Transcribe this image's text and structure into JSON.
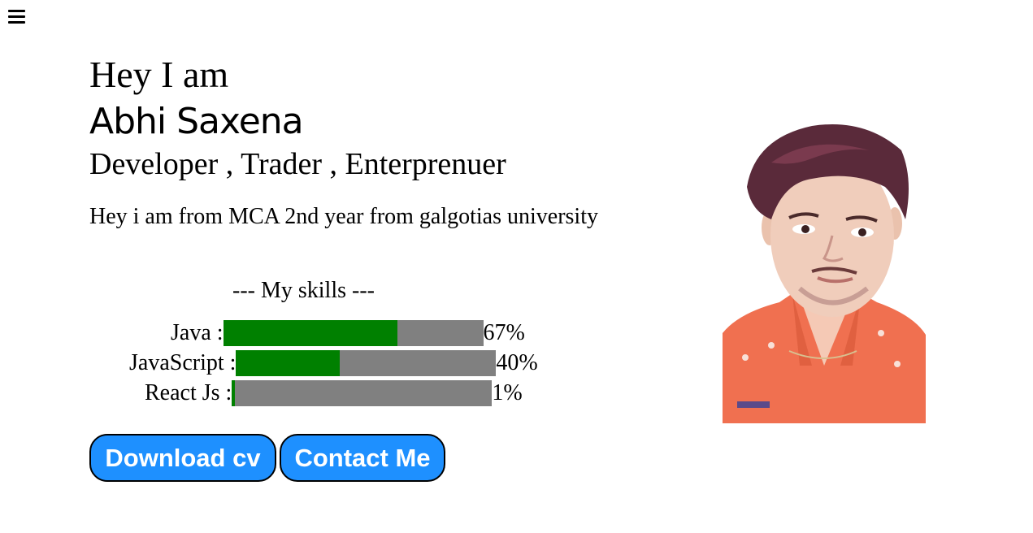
{
  "header": {
    "menu_icon": "hamburger-menu-icon"
  },
  "intro": {
    "greeting": "Hey I am",
    "name": "Abhi Saxena",
    "roles": "Developer , Trader , Enterprenuer",
    "about": "Hey i am from MCA 2nd year from galgotias university"
  },
  "skills": {
    "title": "--- My skills ---",
    "items": [
      {
        "label": "Java :",
        "percent_text": "67%",
        "level": 0.67
      },
      {
        "label": "JavaScript :",
        "percent_text": "40%",
        "level": 0.4
      },
      {
        "label": "React Js :",
        "percent_text": "1%",
        "level": 0.01
      }
    ],
    "colors": {
      "fill": "#008000",
      "track": "#808080"
    }
  },
  "buttons": {
    "download_label": "Download cv",
    "contact_label": "Contact Me",
    "color": "#1e90ff"
  },
  "photo": {
    "icon": "profile-photo",
    "shirt_color": "#f07050"
  }
}
